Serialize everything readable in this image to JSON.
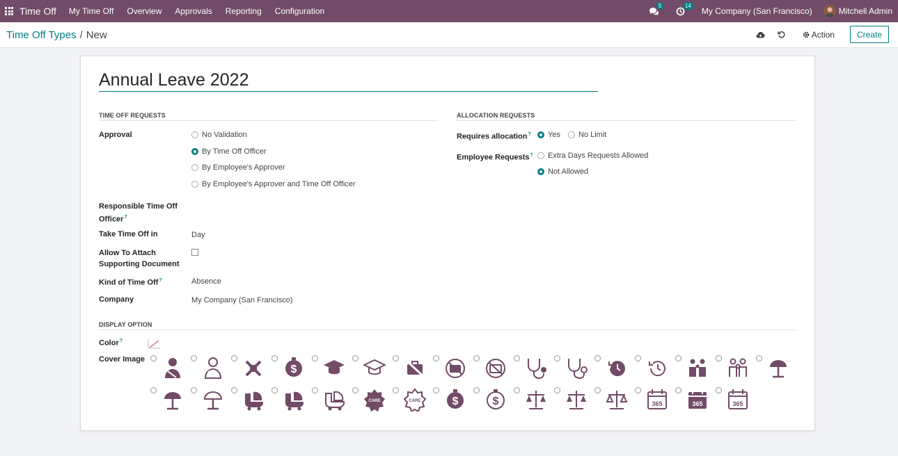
{
  "navbar": {
    "app_name": "Time Off",
    "menu": [
      "My Time Off",
      "Overview",
      "Approvals",
      "Reporting",
      "Configuration"
    ],
    "chat_count": "5",
    "activity_count": "14",
    "company": "My Company (San Francisco)",
    "user": "Mitchell Admin"
  },
  "breadcrumb": {
    "parent": "Time Off Types",
    "separator": "/",
    "current": "New"
  },
  "control": {
    "action_label": "Action",
    "create_label": "Create"
  },
  "form": {
    "name": "Annual Leave 2022",
    "time_off_requests": {
      "section_title": "TIME OFF REQUESTS",
      "approval_label": "Approval",
      "approval_options": [
        "No Validation",
        "By Time Off Officer",
        "By Employee's Approver",
        "By Employee's Approver and Time Off Officer"
      ],
      "approval_selected": "By Time Off Officer",
      "responsible_label_1": "Responsible Time Off",
      "responsible_label_2": "Officer",
      "take_time_off_label": "Take Time Off in",
      "take_time_off_value": "Day",
      "attach_label_1": "Allow To Attach",
      "attach_label_2": "Supporting Document",
      "attach_checked": false,
      "kind_label": "Kind of Time Off",
      "kind_value": "Absence",
      "company_label": "Company",
      "company_value": "My Company (San Francisco)"
    },
    "allocation_requests": {
      "section_title": "ALLOCATION REQUESTS",
      "requires_label": "Requires allocation",
      "requires_options": [
        "Yes",
        "No Limit"
      ],
      "requires_selected": "Yes",
      "employee_requests_label": "Employee Requests",
      "employee_options": [
        "Extra Days Requests Allowed",
        "Not Allowed"
      ],
      "employee_selected": "Not Allowed"
    },
    "display_option": {
      "section_title": "DISPLAY OPTION",
      "color_label": "Color",
      "cover_image_label": "Cover Image",
      "cover_icons": [
        "user-injured-icon",
        "user-injured-outline-icon",
        "cross-pen-icon",
        "dollar-stamp-icon",
        "graduation-cap-icon",
        "graduation-cap-outline-icon",
        "no-briefcase-icon",
        "no-briefcase-round-icon",
        "no-briefcase-round-outline-icon",
        "stethoscope-icon",
        "stethoscope-outline-icon",
        "history-icon",
        "history-outline-icon",
        "family-icon",
        "family-outline-icon",
        "beach-umbrella-icon",
        "beach-umbrella-round-icon",
        "beach-umbrella-round-outline-icon",
        "baby-carriage-icon",
        "baby-carriage-alt-icon",
        "baby-carriage-outline-icon",
        "badge-icon",
        "badge-outline-icon",
        "dollar-round-icon",
        "dollar-round-outline-icon",
        "scale-icon",
        "scale-alt-icon",
        "scale-outline-icon",
        "calendar-365-outline-icon",
        "calendar-365-icon",
        "calendar-365-alt-outline-icon"
      ]
    }
  },
  "colors": {
    "brand": "#714b67",
    "accent": "#017e84",
    "icon": "#714b67"
  }
}
